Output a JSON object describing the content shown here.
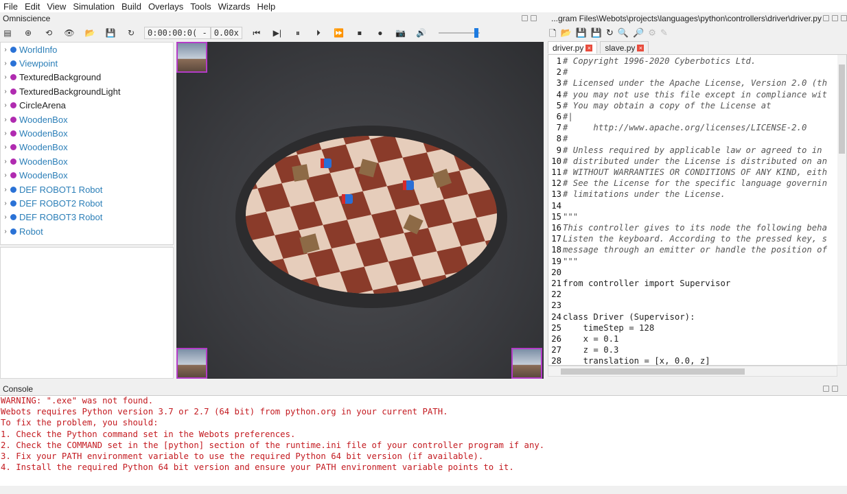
{
  "menu": [
    "File",
    "Edit",
    "View",
    "Simulation",
    "Build",
    "Overlays",
    "Tools",
    "Wizards",
    "Help"
  ],
  "omniscience": {
    "title": "Omniscience",
    "time": "0:00:00:0( -",
    "speed": "0.00x"
  },
  "scene_tree": [
    {
      "label": "WorldInfo",
      "color": "#2c7fb8",
      "dot": "#2a72d6"
    },
    {
      "label": "Viewpoint",
      "color": "#2c7fb8",
      "dot": "#2a72d6"
    },
    {
      "label": "TexturedBackground",
      "color": "#222",
      "dot": "#b02bb0"
    },
    {
      "label": "TexturedBackgroundLight",
      "color": "#222",
      "dot": "#b02bb0"
    },
    {
      "label": "CircleArena",
      "color": "#222",
      "dot": "#b02bb0"
    },
    {
      "label": "WoodenBox",
      "color": "#2c7fb8",
      "dot": "#b02bb0"
    },
    {
      "label": "WoodenBox",
      "color": "#2c7fb8",
      "dot": "#b02bb0"
    },
    {
      "label": "WoodenBox",
      "color": "#2c7fb8",
      "dot": "#b02bb0"
    },
    {
      "label": "WoodenBox",
      "color": "#2c7fb8",
      "dot": "#b02bb0"
    },
    {
      "label": "WoodenBox",
      "color": "#2c7fb8",
      "dot": "#b02bb0"
    },
    {
      "label": "DEF ROBOT1 Robot",
      "color": "#2c7fb8",
      "dot": "#2a72d6"
    },
    {
      "label": "DEF ROBOT2 Robot",
      "color": "#2c7fb8",
      "dot": "#2a72d6"
    },
    {
      "label": "DEF ROBOT3 Robot",
      "color": "#2c7fb8",
      "dot": "#2a72d6"
    },
    {
      "label": "Robot",
      "color": "#2c7fb8",
      "dot": "#2a72d6"
    }
  ],
  "editor": {
    "title": "...gram Files\\Webots\\projects\\languages\\python\\controllers\\driver\\driver.py",
    "tabs": [
      "driver.py",
      "slave.py"
    ],
    "lines": [
      {
        "n": "1",
        "t": "# Copyright 1996-2020 Cyberbotics Ltd.",
        "c": "cmt"
      },
      {
        "n": "2",
        "t": "#",
        "c": "cmt"
      },
      {
        "n": "3",
        "t": "# Licensed under the Apache License, Version 2.0 (th",
        "c": "cmt"
      },
      {
        "n": "4",
        "t": "# you may not use this file except in compliance wit",
        "c": "cmt"
      },
      {
        "n": "5",
        "t": "# You may obtain a copy of the License at",
        "c": "cmt"
      },
      {
        "n": "6",
        "t": "#|",
        "c": "cmt"
      },
      {
        "n": "7",
        "t": "#     http://www.apache.org/licenses/LICENSE-2.0",
        "c": "cmt"
      },
      {
        "n": "8",
        "t": "#",
        "c": "cmt"
      },
      {
        "n": "9",
        "t": "# Unless required by applicable law or agreed to in",
        "c": "cmt"
      },
      {
        "n": "10",
        "t": "# distributed under the License is distributed on an",
        "c": "cmt"
      },
      {
        "n": "11",
        "t": "# WITHOUT WARRANTIES OR CONDITIONS OF ANY KIND, eith",
        "c": "cmt"
      },
      {
        "n": "12",
        "t": "# See the License for the specific language governin",
        "c": "cmt"
      },
      {
        "n": "13",
        "t": "# limitations under the License.",
        "c": "cmt"
      },
      {
        "n": "14",
        "t": "",
        "c": ""
      },
      {
        "n": "15",
        "t": "\"\"\"",
        "c": "cmt"
      },
      {
        "n": "16",
        "t": "This controller gives to its node the following beha",
        "c": "cmt"
      },
      {
        "n": "17",
        "t": "Listen the keyboard. According to the pressed key, s",
        "c": "cmt"
      },
      {
        "n": "18",
        "t": "message through an emitter or handle the position of",
        "c": "cmt"
      },
      {
        "n": "19",
        "t": "\"\"\"",
        "c": "cmt"
      },
      {
        "n": "20",
        "t": "",
        "c": ""
      },
      {
        "n": "21",
        "t": "from controller import Supervisor",
        "c": "kw"
      },
      {
        "n": "22",
        "t": "",
        "c": ""
      },
      {
        "n": "23",
        "t": "",
        "c": ""
      },
      {
        "n": "24",
        "t": "class Driver (Supervisor):",
        "c": "kw"
      },
      {
        "n": "25",
        "t": "    timeStep = 128",
        "c": "num"
      },
      {
        "n": "26",
        "t": "    x = 0.1",
        "c": "num"
      },
      {
        "n": "27",
        "t": "    z = 0.3",
        "c": "num"
      },
      {
        "n": "28",
        "t": "    translation = [x, 0.0, z]",
        "c": "num"
      }
    ]
  },
  "console": {
    "title": "Console",
    "lines": [
      "WARNING: \".exe\" was not found.",
      "Webots requires Python version 3.7 or 2.7 (64 bit) from python.org in your current PATH.",
      "To fix the problem, you should:",
      "1. Check the Python command set in the Webots preferences.",
      "2. Check the COMMAND set in the [python] section of the runtime.ini file of your controller program if any.",
      "3. Fix your PATH environment variable to use the required Python 64 bit version (if available).",
      "4. Install the required Python 64 bit version and ensure your PATH environment variable points to it."
    ]
  },
  "colors": {
    "tree_link": "#2c7fb8",
    "console_error": "#c3191f",
    "thumb_border": "#b43cc8"
  }
}
